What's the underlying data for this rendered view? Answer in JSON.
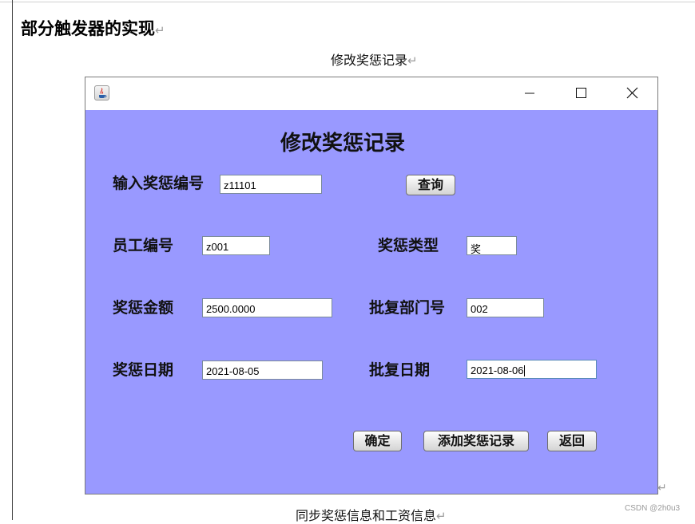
{
  "document": {
    "heading": "部分触发器的实现",
    "return_mark": "↵",
    "caption_top": "修改奖惩记录",
    "caption_bottom": "同步奖惩信息和工资信息",
    "end_mark": "↵",
    "watermark": "CSDN @2h0u3"
  },
  "window": {
    "icon": "java-app-icon",
    "controls": [
      "minimize-icon",
      "maximize-icon",
      "close-icon"
    ],
    "background_color": "#9999ff",
    "form_title": "修改奖惩记录",
    "query_label": "输入奖惩编号",
    "query_value": "z11101",
    "query_button": "查询",
    "fields": {
      "employee_id": {
        "label": "员工编号",
        "value": "z001"
      },
      "type": {
        "label": "奖惩类型",
        "value": "奖"
      },
      "amount": {
        "label": "奖惩金额",
        "value": "2500.0000"
      },
      "dept": {
        "label": "批复部门号",
        "value": "002"
      },
      "date": {
        "label": "奖惩日期",
        "value": "2021-08-05"
      },
      "approve_date": {
        "label": "批复日期",
        "value": "2021-08-06"
      }
    },
    "buttons": {
      "confirm": "确定",
      "add": "添加奖惩记录",
      "back": "返回"
    }
  }
}
